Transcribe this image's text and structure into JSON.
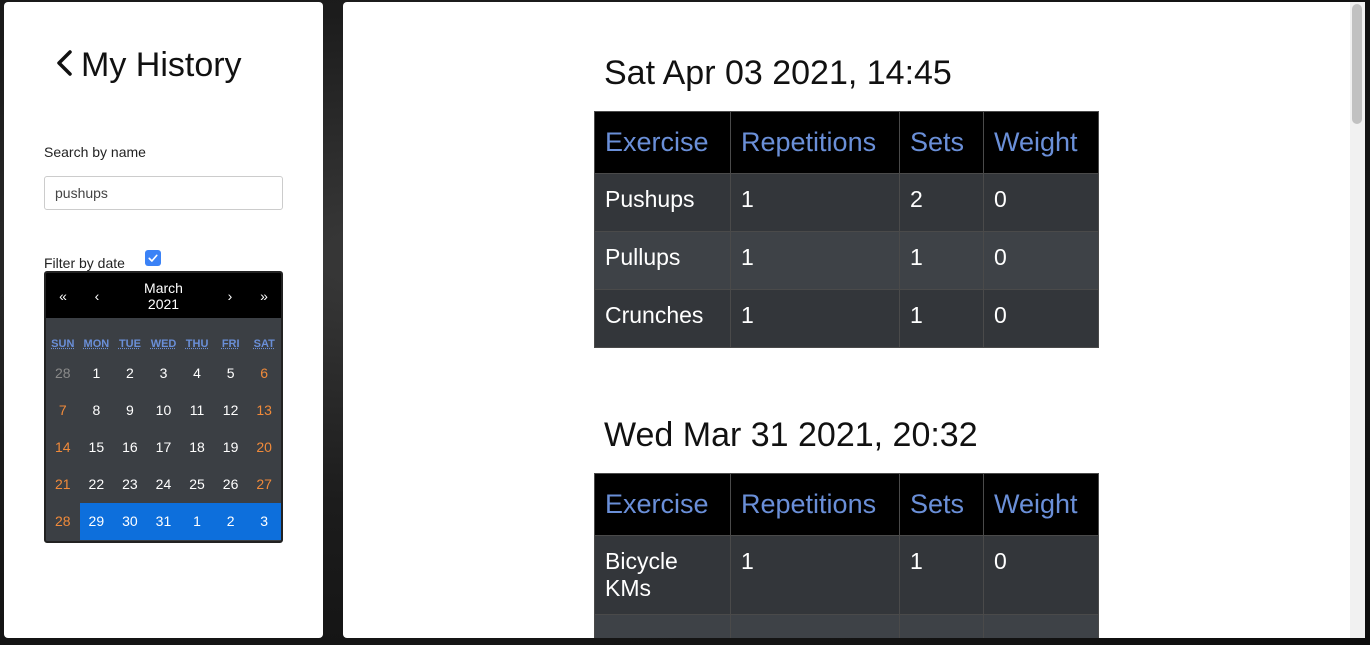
{
  "sidebar": {
    "title": "My History",
    "search_label": "Search by name",
    "search_value": "pushups",
    "filter_label": "Filter by date",
    "filter_checked": true
  },
  "calendar": {
    "prev_year": "«",
    "prev_month": "‹",
    "next_month": "›",
    "next_year": "»",
    "month": "March",
    "year": "2021",
    "weekdays": [
      "SUN",
      "MON",
      "TUE",
      "WED",
      "THU",
      "FRI",
      "SAT"
    ],
    "days": [
      [
        "28",
        "1",
        "2",
        "3",
        "4",
        "5",
        "6"
      ],
      [
        "7",
        "8",
        "9",
        "10",
        "11",
        "12",
        "13"
      ],
      [
        "14",
        "15",
        "16",
        "17",
        "18",
        "19",
        "20"
      ],
      [
        "21",
        "22",
        "23",
        "24",
        "25",
        "26",
        "27"
      ],
      [
        "28",
        "29",
        "30",
        "31",
        "1",
        "2",
        "3"
      ]
    ],
    "accent_selected": "#0d6fdc",
    "weekend_color": "#f08a3a"
  },
  "sessions": [
    {
      "title": "Sat Apr 03 2021, 14:45",
      "headers": [
        "Exercise",
        "Repetitions",
        "Sets",
        "Weight"
      ],
      "rows": [
        [
          "Pushups",
          "1",
          "2",
          "0"
        ],
        [
          "Pullups",
          "1",
          "1",
          "0"
        ],
        [
          "Crunches",
          "1",
          "1",
          "0"
        ]
      ]
    },
    {
      "title": "Wed Mar 31 2021, 20:32",
      "headers": [
        "Exercise",
        "Repetitions",
        "Sets",
        "Weight"
      ],
      "rows": [
        [
          "Bicycle KMs",
          "1",
          "1",
          "0"
        ],
        [
          "",
          "",
          "",
          ""
        ]
      ]
    }
  ]
}
